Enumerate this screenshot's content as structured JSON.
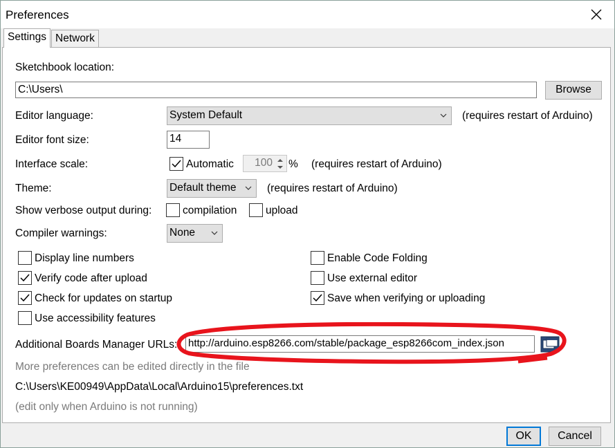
{
  "window": {
    "title": "Preferences"
  },
  "tabs": [
    {
      "label": "Settings"
    },
    {
      "label": "Network"
    }
  ],
  "sketchbook": {
    "label": "Sketchbook location:",
    "value": "C:\\Users\\",
    "browse_label": "Browse"
  },
  "editor_language": {
    "label": "Editor language:",
    "value": "System Default",
    "note": "(requires restart of Arduino)"
  },
  "editor_font_size": {
    "label": "Editor font size:",
    "value": "14"
  },
  "interface_scale": {
    "label": "Interface scale:",
    "automatic_label": "Automatic",
    "automatic_checked": true,
    "value": "100",
    "percent": "%",
    "note": "(requires restart of Arduino)"
  },
  "theme": {
    "label": "Theme:",
    "value": "Default theme",
    "note": "(requires restart of Arduino)"
  },
  "verbose": {
    "label": "Show verbose output during:",
    "compilation_label": "compilation",
    "compilation_checked": false,
    "upload_label": "upload",
    "upload_checked": false
  },
  "compiler_warnings": {
    "label": "Compiler warnings:",
    "value": "None"
  },
  "options_left": [
    {
      "label": "Display line numbers",
      "checked": false
    },
    {
      "label": "Verify code after upload",
      "checked": true
    },
    {
      "label": "Check for updates on startup",
      "checked": true
    },
    {
      "label": "Use accessibility features",
      "checked": false
    }
  ],
  "options_right": [
    {
      "label": "Enable Code Folding",
      "checked": false
    },
    {
      "label": "Use external editor",
      "checked": false
    },
    {
      "label": "Save when verifying or uploading",
      "checked": true
    }
  ],
  "boards_urls": {
    "label": "Additional Boards Manager URLs:",
    "value": "http://arduino.esp8266.com/stable/package_esp8266com_index.json"
  },
  "footer": {
    "more_prefs": "More preferences can be edited directly in the file",
    "path": "C:\\Users\\KE00949\\AppData\\Local\\Arduino15\\preferences.txt",
    "edit_note": "(edit only when Arduino is not running)"
  },
  "buttons": {
    "ok": "OK",
    "cancel": "Cancel"
  },
  "colors": {
    "annotation": "#e8141c",
    "focus_blue": "#0078d7",
    "dialog_bg": "#f0f0f0"
  }
}
